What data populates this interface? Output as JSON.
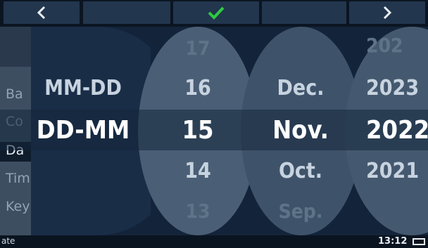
{
  "toolbar": {
    "back_icon": "chevron-left-icon",
    "confirm_icon": "checkmark-icon",
    "forward_icon": "chevron-right-icon",
    "accent": "#2ecc40"
  },
  "background_menu": {
    "items": [
      "Ba",
      "Co",
      "Da",
      "Tim",
      "Key"
    ],
    "active_index": 2
  },
  "format_wheel": {
    "above": "MM-DD",
    "selected": "DD-MM"
  },
  "day_wheel": {
    "far_above": "17",
    "above": "16",
    "selected": "15",
    "below": "14",
    "far_below": "13"
  },
  "month_wheel": {
    "above": "Dec.",
    "selected": "Nov.",
    "below": "Oct.",
    "far_below": "Sep."
  },
  "year_wheel": {
    "far_above": "202",
    "above": "2023",
    "selected": "2022",
    "below": "2021"
  },
  "statusbar": {
    "left_text": "ate",
    "time": "13:12"
  }
}
